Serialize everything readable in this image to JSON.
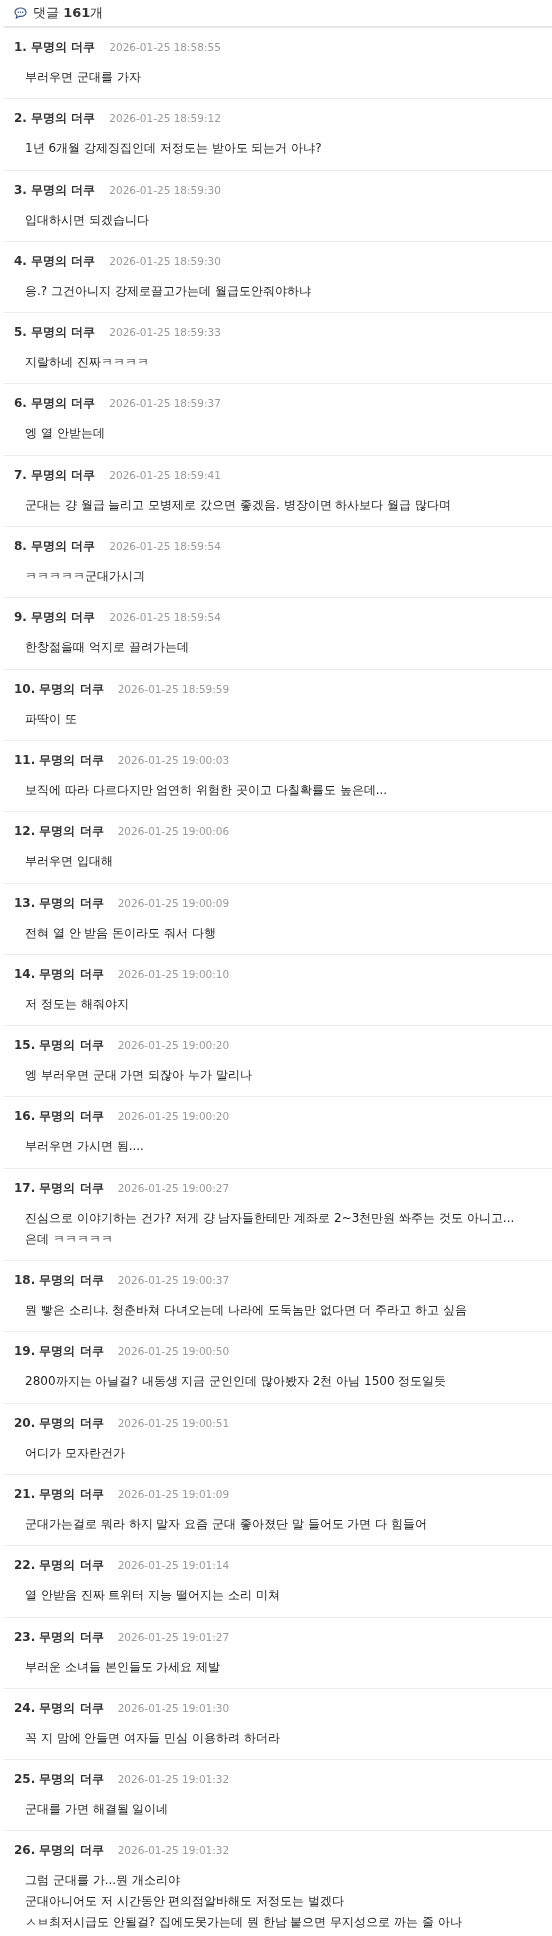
{
  "header": {
    "title": "댓글 **161**개"
  },
  "comments": [
    {
      "number": "1.",
      "author": "무명의 더쿠",
      "time": "2026-01-25 18:58:55",
      "text": "부러우면 군대를 가자"
    },
    {
      "number": "2.",
      "author": "무명의 더쿠",
      "time": "2026-01-25 18:59:12",
      "text": "1년 6개월 강제징집인데 저정도는 받아도 되는거 아냐?"
    },
    {
      "number": "3.",
      "author": "무명의 더쿠",
      "time": "2026-01-25 18:59:30",
      "text": "입대하시면 되겠습니다"
    },
    {
      "number": "4.",
      "author": "무명의 더쿠",
      "time": "2026-01-25 18:59:30",
      "text": "응.? 그건아니지 강제로끌고가는데 월급도안줘야하냐"
    },
    {
      "number": "5.",
      "author": "무명의 더쿠",
      "time": "2026-01-25 18:59:33",
      "text": "지랄하네 진짜ㅋㅋㅋㅋ"
    },
    {
      "number": "6.",
      "author": "무명의 더쿠",
      "time": "2026-01-25 18:59:37",
      "text": "엥 열 안받는데"
    },
    {
      "number": "7.",
      "author": "무명의 더쿠",
      "time": "2026-01-25 18:59:41",
      "text": "군대는 걍 월급 늘리고 모병제로 갔으면 좋겠음. 병장이면 하사보다 월급 많다며"
    },
    {
      "number": "8.",
      "author": "무명의 더쿠",
      "time": "2026-01-25 18:59:54",
      "text": "ㅋㅋㅋㅋㅋ군대가시긔"
    },
    {
      "number": "9.",
      "author": "무명의 더쿠",
      "time": "2026-01-25 18:59:54",
      "text": "한창젊을때 억지로 끌려가는데"
    },
    {
      "number": "10.",
      "author": "무명의 더쿠",
      "time": "2026-01-25 18:59:59",
      "text": "파딱이 또"
    },
    {
      "number": "11.",
      "author": "무명의 더쿠",
      "time": "2026-01-25 19:00:03",
      "text": "보직에 따라 다르다지만 엄연히 위험한 곳이고 다칠확률도 높은데..."
    },
    {
      "number": "12.",
      "author": "무명의 더쿠",
      "time": "2026-01-25 19:00:06",
      "text": "부러우면 입대해"
    },
    {
      "number": "13.",
      "author": "무명의 더쿠",
      "time": "2026-01-25 19:00:09",
      "text": "전혀 열 안 받음 돈이라도 줘서 다행"
    },
    {
      "number": "14.",
      "author": "무명의 더쿠",
      "time": "2026-01-25 19:00:10",
      "text": "저 정도는 해줘야지"
    },
    {
      "number": "15.",
      "author": "무명의 더쿠",
      "time": "2026-01-25 19:00:20",
      "text": "엥 부러우면 군대 가면 되잖아 누가 말리나"
    },
    {
      "number": "16.",
      "author": "무명의 더쿠",
      "time": "2026-01-25 19:00:20",
      "text": "부러우면 가시면 됨...."
    },
    {
      "number": "17.",
      "author": "무명의 더쿠",
      "time": "2026-01-25 19:00:27",
      "text": "진심으로 이야기하는 건가? 저게 걍 남자들한테만 계좌로 2~3천만원 쏴주는 것도 아니고...\n은데 ㅋㅋㅋㅋㅋ"
    },
    {
      "number": "18.",
      "author": "무명의 더쿠",
      "time": "2026-01-25 19:00:37",
      "text": "뭔 빻은 소리냐. 청춘바쳐 다녀오는데 나라에 도둑놈만 없다면 더 주라고 하고 싶음"
    },
    {
      "number": "19.",
      "author": "무명의 더쿠",
      "time": "2026-01-25 19:00:50",
      "text": "2800까지는 아닐걸? 내동생 지금 군인인데 많아봤자 2천 아님 1500 정도일듯"
    },
    {
      "number": "20.",
      "author": "무명의 더쿠",
      "time": "2026-01-25 19:00:51",
      "text": "어디가 모자란건가"
    },
    {
      "number": "21.",
      "author": "무명의 더쿠",
      "time": "2026-01-25 19:01:09",
      "text": "군대가는걸로 뭐라 하지 말자 요즘 군대 좋아졌단 말 들어도 가면 다 힘들어"
    },
    {
      "number": "22.",
      "author": "무명의 더쿠",
      "time": "2026-01-25 19:01:14",
      "text": "열 안받음 진짜 트위터 지능 떨어지는 소리 미쳐"
    },
    {
      "number": "23.",
      "author": "무명의 더쿠",
      "time": "2026-01-25 19:01:27",
      "text": "부러운 소녀들 본인들도 가세요 제발"
    },
    {
      "number": "24.",
      "author": "무명의 더쿠",
      "time": "2026-01-25 19:01:30",
      "text": "꼭 지 맘에 안들면 여자들 민심 이용하려 하더라"
    },
    {
      "number": "25.",
      "author": "무명의 더쿠",
      "time": "2026-01-25 19:01:32",
      "text": "군대를 가면 해결될 일이네"
    },
    {
      "number": "26.",
      "author": "무명의 더쿠",
      "time": "2026-01-25 19:01:32",
      "text": "그럼 군대를 가...뭔 개소리야\n군대아니어도 저 시간동안 편의점알바해도 저정도는 벌겠다\nㅅㅂ최저시급도 안될걸? 집에도못가는데 뭔 한남 붙으면 무지성으로 까는 줄 아나"
    }
  ]
}
